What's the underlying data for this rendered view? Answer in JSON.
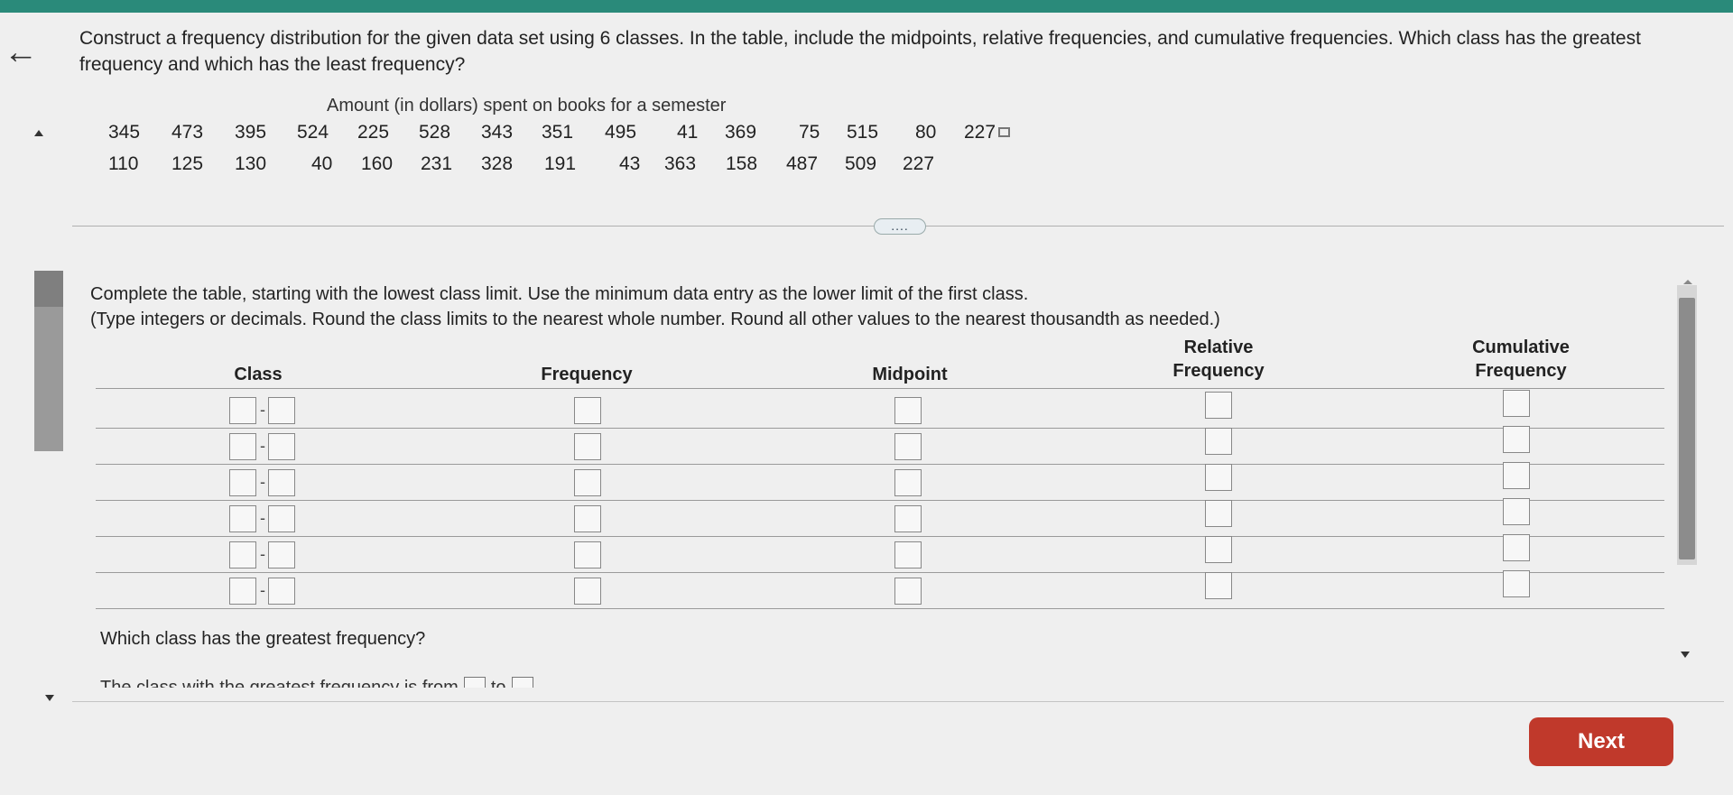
{
  "question": {
    "text": "Construct a frequency distribution for the given data set using 6 classes. In the table, include the midpoints, relative frequencies, and cumulative frequencies. Which class has the greatest frequency and which has the least frequency?"
  },
  "dataset": {
    "title": "Amount (in dollars) spent on books for a semester",
    "row1": [
      "345",
      "473",
      "395",
      "524",
      "225",
      "528",
      "343",
      "351",
      "495",
      "41",
      "369",
      "75",
      "515",
      "80",
      "227"
    ],
    "row2": [
      "110",
      "125",
      "130",
      "40",
      "160",
      "231",
      "328",
      "191",
      "43",
      "363",
      "158",
      "487",
      "509",
      "227"
    ]
  },
  "more_button": "....",
  "instructions": {
    "line1": "Complete the table, starting with the lowest class limit. Use the minimum data entry as the lower limit of the first class.",
    "line2": "(Type integers or decimals. Round the class limits to the nearest whole number. Round all other values to the nearest thousandth as needed.)"
  },
  "table": {
    "headers": {
      "class": "Class",
      "frequency": "Frequency",
      "midpoint": "Midpoint",
      "relative_line1": "Relative",
      "relative_line2": "Frequency",
      "cumulative_line1": "Cumulative",
      "cumulative_line2": "Frequency"
    },
    "separator": "-"
  },
  "greatest_question": "Which class has the greatest frequency?",
  "answer_text": {
    "prefix": "The class with the greatest frequency is from",
    "middle": "to"
  },
  "next_button": "Next",
  "colors": {
    "next_button": "#c0392b",
    "topbar": "#2a8a7a"
  }
}
